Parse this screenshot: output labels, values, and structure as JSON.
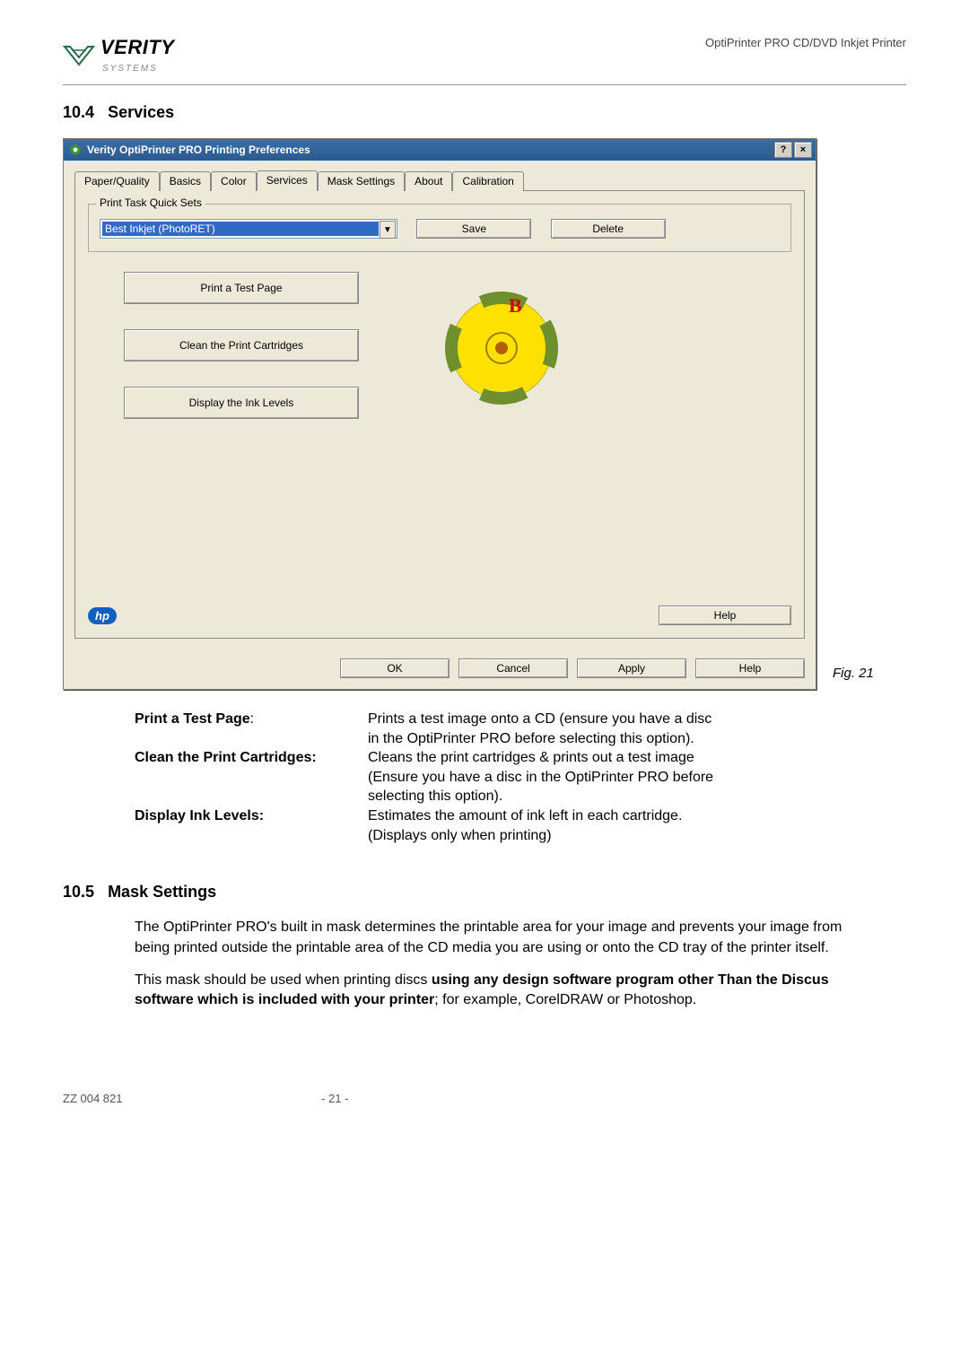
{
  "header": {
    "logo_main": "VERITY",
    "logo_sub": "SYSTEMS",
    "doc_title": "OptiPrinter PRO CD/DVD Inkjet Printer"
  },
  "section_104": {
    "number": "10.4",
    "title": "Services"
  },
  "dialog": {
    "title": "Verity OptiPrinter PRO Printing Preferences",
    "help_glyph": "?",
    "close_glyph": "×",
    "tabs": [
      "Paper/Quality",
      "Basics",
      "Color",
      "Services",
      "Mask Settings",
      "About",
      "Calibration"
    ],
    "active_tab_index": 3,
    "groupbox_label": "Print Task Quick Sets",
    "combo_value": "Best Inkjet (PhotoRET)",
    "save_label": "Save",
    "delete_label": "Delete",
    "btn_test": "Print a Test Page",
    "btn_clean": "Clean the Print Cartridges",
    "btn_levels": "Display the Ink Levels",
    "hp_label": "hp",
    "help_label": "Help",
    "ok_label": "OK",
    "cancel_label": "Cancel",
    "apply_label": "Apply",
    "bottom_help_label": "Help",
    "disc_letter": "B"
  },
  "fig21_label": "Fig. 21",
  "definitions": {
    "test_term": "Print a Test Page",
    "test_colon": ":",
    "test_desc1": "Prints a test image onto a CD (ensure you have a disc",
    "test_desc2": "in the OptiPrinter PRO before selecting this option).",
    "clean_term": "Clean the Print Cartridges:",
    "clean_desc1": "Cleans the print cartridges & prints out a test image",
    "clean_desc2": "(Ensure you have a disc in the OptiPrinter PRO before",
    "clean_desc3": "selecting this option).",
    "levels_term": "Display Ink Levels:",
    "levels_desc1": "Estimates the amount of ink left in each cartridge.",
    "levels_desc2": "(Displays only when printing)"
  },
  "section_105": {
    "number": "10.5",
    "title": "Mask Settings"
  },
  "para1": "The OptiPrinter PRO's built in mask determines the printable area for your image and prevents your image from being printed outside the printable area of the CD media you are using or onto the CD tray of the printer itself.",
  "para2_a": "This mask should be used when printing discs ",
  "para2_b": "using any design software program other Than the Discus software which is included with your printer",
  "para2_c": "; for example, CorelDRAW or Photoshop.",
  "footer": {
    "left": "ZZ 004 821",
    "center": "- 21 -"
  }
}
